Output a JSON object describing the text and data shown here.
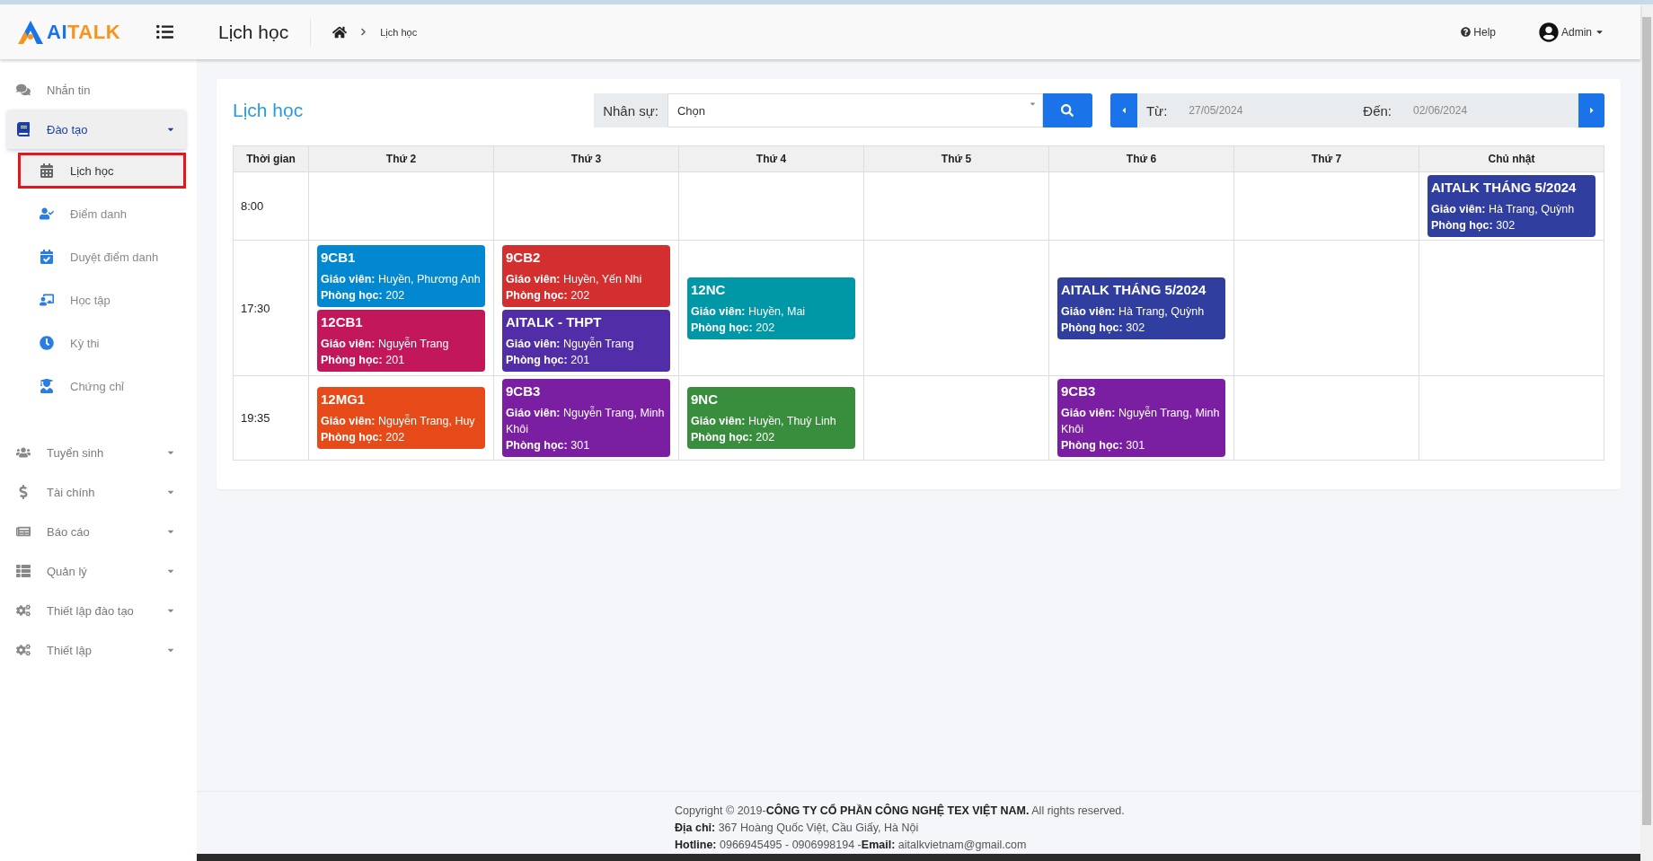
{
  "logo": {
    "parts": [
      "AI",
      "TALK"
    ]
  },
  "header": {
    "title": "Lịch học",
    "breadcrumb": "Lịch học",
    "help": "Help",
    "user": "Admin"
  },
  "sidebar": {
    "items": [
      {
        "kind": "link",
        "label": "Nhắn tin"
      },
      {
        "kind": "group",
        "label": "Đào tạo",
        "expanded": true,
        "children": [
          {
            "label": "Lịch học",
            "selected": true
          },
          {
            "label": "Điểm danh",
            "selected": false
          },
          {
            "label": "Duyệt điểm danh",
            "selected": false
          },
          {
            "label": "Học tập",
            "selected": false
          },
          {
            "label": "Kỳ thi",
            "selected": false
          },
          {
            "label": "Chứng chỉ",
            "selected": false
          }
        ]
      },
      {
        "kind": "group",
        "label": "Tuyển sinh",
        "expanded": false
      },
      {
        "kind": "group",
        "label": "Tài chính",
        "expanded": false
      },
      {
        "kind": "group",
        "label": "Báo cáo",
        "expanded": false
      },
      {
        "kind": "group",
        "label": "Quản lý",
        "expanded": false
      },
      {
        "kind": "group",
        "label": "Thiết lập đào tạo",
        "expanded": false
      },
      {
        "kind": "group",
        "label": "Thiết lập",
        "expanded": false
      }
    ]
  },
  "card": {
    "title": "Lịch học"
  },
  "filters": {
    "staff_label": "Nhân sự:",
    "staff_value": "Chọn",
    "from_label": "Từ:",
    "from_value": "27/05/2024",
    "to_label": "Đến:",
    "to_value": "02/06/2024"
  },
  "table": {
    "time_header": "Thời gian",
    "days": [
      "Thứ 2",
      "Thứ 3",
      "Thứ 4",
      "Thứ 5",
      "Thứ 6",
      "Thứ 7",
      "Chủ nhật"
    ],
    "rows": [
      {
        "time": "8:00",
        "days": [
          {
            "kind": "free"
          },
          {
            "kind": "free"
          },
          {
            "kind": "free"
          },
          {
            "kind": "free"
          },
          {
            "kind": "free"
          },
          {
            "kind": "free"
          },
          {
            "kind": "classes",
            "events": [
              {
                "title": "AITALK THÁNG 5/2024",
                "teacher": "**Giáo viên:** Hà Trang, Quỳnh",
                "room": "**Phòng học:** 302",
                "color": "#303f9f"
              }
            ]
          }
        ]
      },
      {
        "time": "17:30",
        "days": [
          {
            "kind": "classes",
            "events": [
              {
                "title": "9CB1",
                "teacher": "**Giáo viên:** Huyền, Phương Anh",
                "room": "**Phòng học:** 202",
                "color": "#0288d1"
              },
              {
                "title": "12CB1",
                "teacher": "**Giáo viên:** Nguyễn Trang",
                "room": "**Phòng học:** 201",
                "color": "#c2185b"
              }
            ]
          },
          {
            "kind": "classes",
            "events": [
              {
                "title": "9CB2",
                "teacher": "**Giáo viên:** Huyền, Yến Nhi",
                "room": "**Phòng học:** 202",
                "color": "#d32f2f"
              },
              {
                "title": "AITALK - THPT",
                "teacher": "**Giáo viên:** Nguyễn Trang",
                "room": "**Phòng học:** 201",
                "color": "#512da8"
              }
            ]
          },
          {
            "kind": "classes",
            "events": [
              {
                "title": "12NC",
                "teacher": "**Giáo viên:** Huyền, Mai",
                "room": "**Phòng học:** 202",
                "color": "#0097a7"
              }
            ]
          },
          {
            "kind": "free"
          },
          {
            "kind": "classes",
            "events": [
              {
                "title": "AITALK THÁNG 5/2024",
                "teacher": "**Giáo viên:** Hà Trang, Quỳnh",
                "room": "**Phòng học:** 302",
                "color": "#303f9f"
              }
            ]
          },
          {
            "kind": "free"
          },
          {
            "kind": "free"
          }
        ]
      },
      {
        "time": "19:35",
        "days": [
          {
            "kind": "classes",
            "events": [
              {
                "title": "12MG1",
                "teacher": "**Giáo viên:** Nguyễn Trang, Huy",
                "room": "**Phòng học:** 202",
                "color": "#e64a19"
              }
            ]
          },
          {
            "kind": "classes",
            "events": [
              {
                "title": "9CB3",
                "teacher": "**Giáo viên:** Nguyễn Trang, Minh Khôi",
                "room": "**Phòng học:** 301",
                "color": "#7b1fa2"
              }
            ]
          },
          {
            "kind": "classes",
            "events": [
              {
                "title": "9NC",
                "teacher": "**Giáo viên:** Huyền, Thuỳ Linh",
                "room": "**Phòng học:** 202",
                "color": "#388e3c"
              }
            ]
          },
          {
            "kind": "free"
          },
          {
            "kind": "classes",
            "events": [
              {
                "title": "9CB3",
                "teacher": "**Giáo viên:** Nguyễn Trang, Minh Khôi",
                "room": "**Phòng học:** 301",
                "color": "#7b1fa2"
              }
            ]
          },
          {
            "kind": "free"
          },
          {
            "kind": "free"
          }
        ]
      }
    ]
  },
  "footer": {
    "lines": [
      "Copyright © 2019-**CÔNG TY CỔ PHẦN CÔNG NGHỆ TEX VIỆT NAM.** All rights reserved.",
      "**Địa chỉ:** 367 Hoàng Quốc Việt, Cầu Giấy, Hà Nội",
      "**Hotline:** 0966945495 - 0906998194 -**Email:** aitalkvietnam@gmail.com"
    ]
  }
}
